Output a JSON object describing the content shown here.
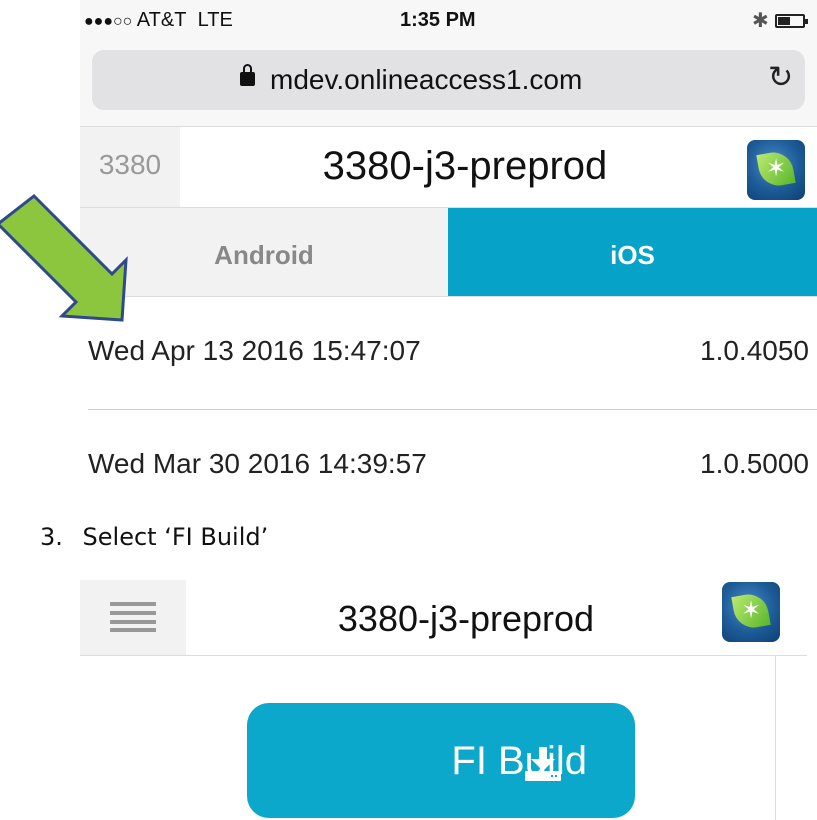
{
  "shot1": {
    "status": {
      "carrier": "AT&T",
      "network": "LTE",
      "time": "1:35 PM"
    },
    "url": "mdev.onlineaccess1.com",
    "app_id": "3380",
    "app_title": "3380-j3-preprod",
    "tabs": [
      {
        "label": "Android",
        "active": false
      },
      {
        "label": "iOS",
        "active": true
      }
    ],
    "builds": [
      {
        "date": "Wed Apr 13 2016 15:47:07",
        "version": "1.0.4050"
      },
      {
        "date": "Wed Mar 30 2016 14:39:57",
        "version": "1.0.5000"
      }
    ]
  },
  "step": {
    "number": "3.",
    "text": "Select ‘FI Build’"
  },
  "shot2": {
    "app_title": "3380-j3-preprod",
    "button_label": "FI Build"
  },
  "colors": {
    "accent": "#06a2c8",
    "arrow_fill": "#8cc63f",
    "arrow_stroke": "#2e4a8b"
  },
  "icons": [
    "lock-icon",
    "reload-icon",
    "bluetooth-icon",
    "battery-icon",
    "app-logo-icon",
    "menu-icon",
    "download-icon",
    "arrow-pointer"
  ]
}
